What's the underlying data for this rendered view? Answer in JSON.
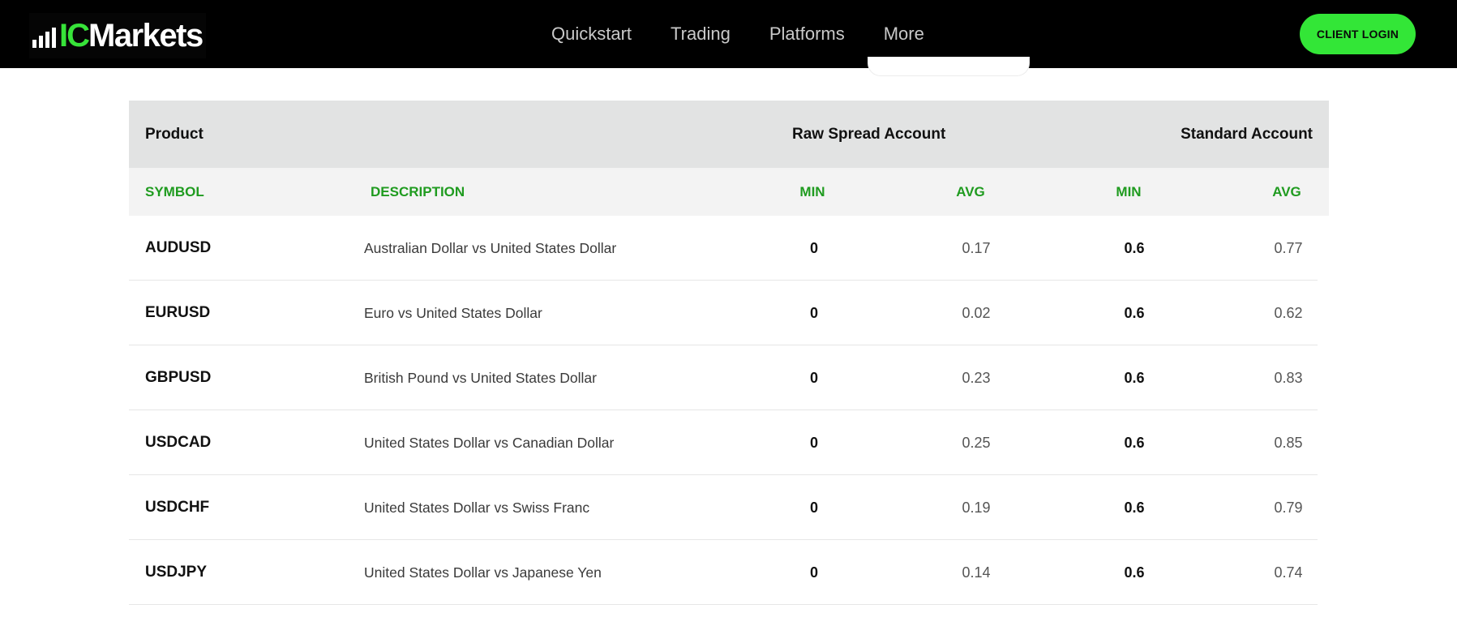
{
  "header": {
    "logo": {
      "prefix": "IC",
      "suffix": "Markets",
      "icon": "bar-chart-icon"
    },
    "nav": [
      {
        "label": "Quickstart"
      },
      {
        "label": "Trading"
      },
      {
        "label": "Platforms"
      },
      {
        "label": "More"
      }
    ],
    "login_label": "CLIENT LOGIN",
    "colors": {
      "accent": "#33e637",
      "background": "#000000"
    }
  },
  "table": {
    "group_headers": {
      "product": "Product",
      "raw": "Raw Spread Account",
      "standard": "Standard Account"
    },
    "columns": {
      "symbol": "SYMBOL",
      "description": "DESCRIPTION",
      "raw_min": "MIN",
      "raw_avg": "AVG",
      "std_min": "MIN",
      "std_avg": "AVG"
    },
    "rows": [
      {
        "symbol": "AUDUSD",
        "description": "Australian Dollar vs United States Dollar",
        "raw_min": "0",
        "raw_avg": "0.17",
        "std_min": "0.6",
        "std_avg": "0.77"
      },
      {
        "symbol": "EURUSD",
        "description": "Euro vs United States Dollar",
        "raw_min": "0",
        "raw_avg": "0.02",
        "std_min": "0.6",
        "std_avg": "0.62"
      },
      {
        "symbol": "GBPUSD",
        "description": "British Pound vs United States Dollar",
        "raw_min": "0",
        "raw_avg": "0.23",
        "std_min": "0.6",
        "std_avg": "0.83"
      },
      {
        "symbol": "USDCAD",
        "description": "United States Dollar vs Canadian Dollar",
        "raw_min": "0",
        "raw_avg": "0.25",
        "std_min": "0.6",
        "std_avg": "0.85"
      },
      {
        "symbol": "USDCHF",
        "description": "United States Dollar vs Swiss Franc",
        "raw_min": "0",
        "raw_avg": "0.19",
        "std_min": "0.6",
        "std_avg": "0.79"
      },
      {
        "symbol": "USDJPY",
        "description": "United States Dollar vs Japanese Yen",
        "raw_min": "0",
        "raw_avg": "0.14",
        "std_min": "0.6",
        "std_avg": "0.74"
      }
    ]
  }
}
